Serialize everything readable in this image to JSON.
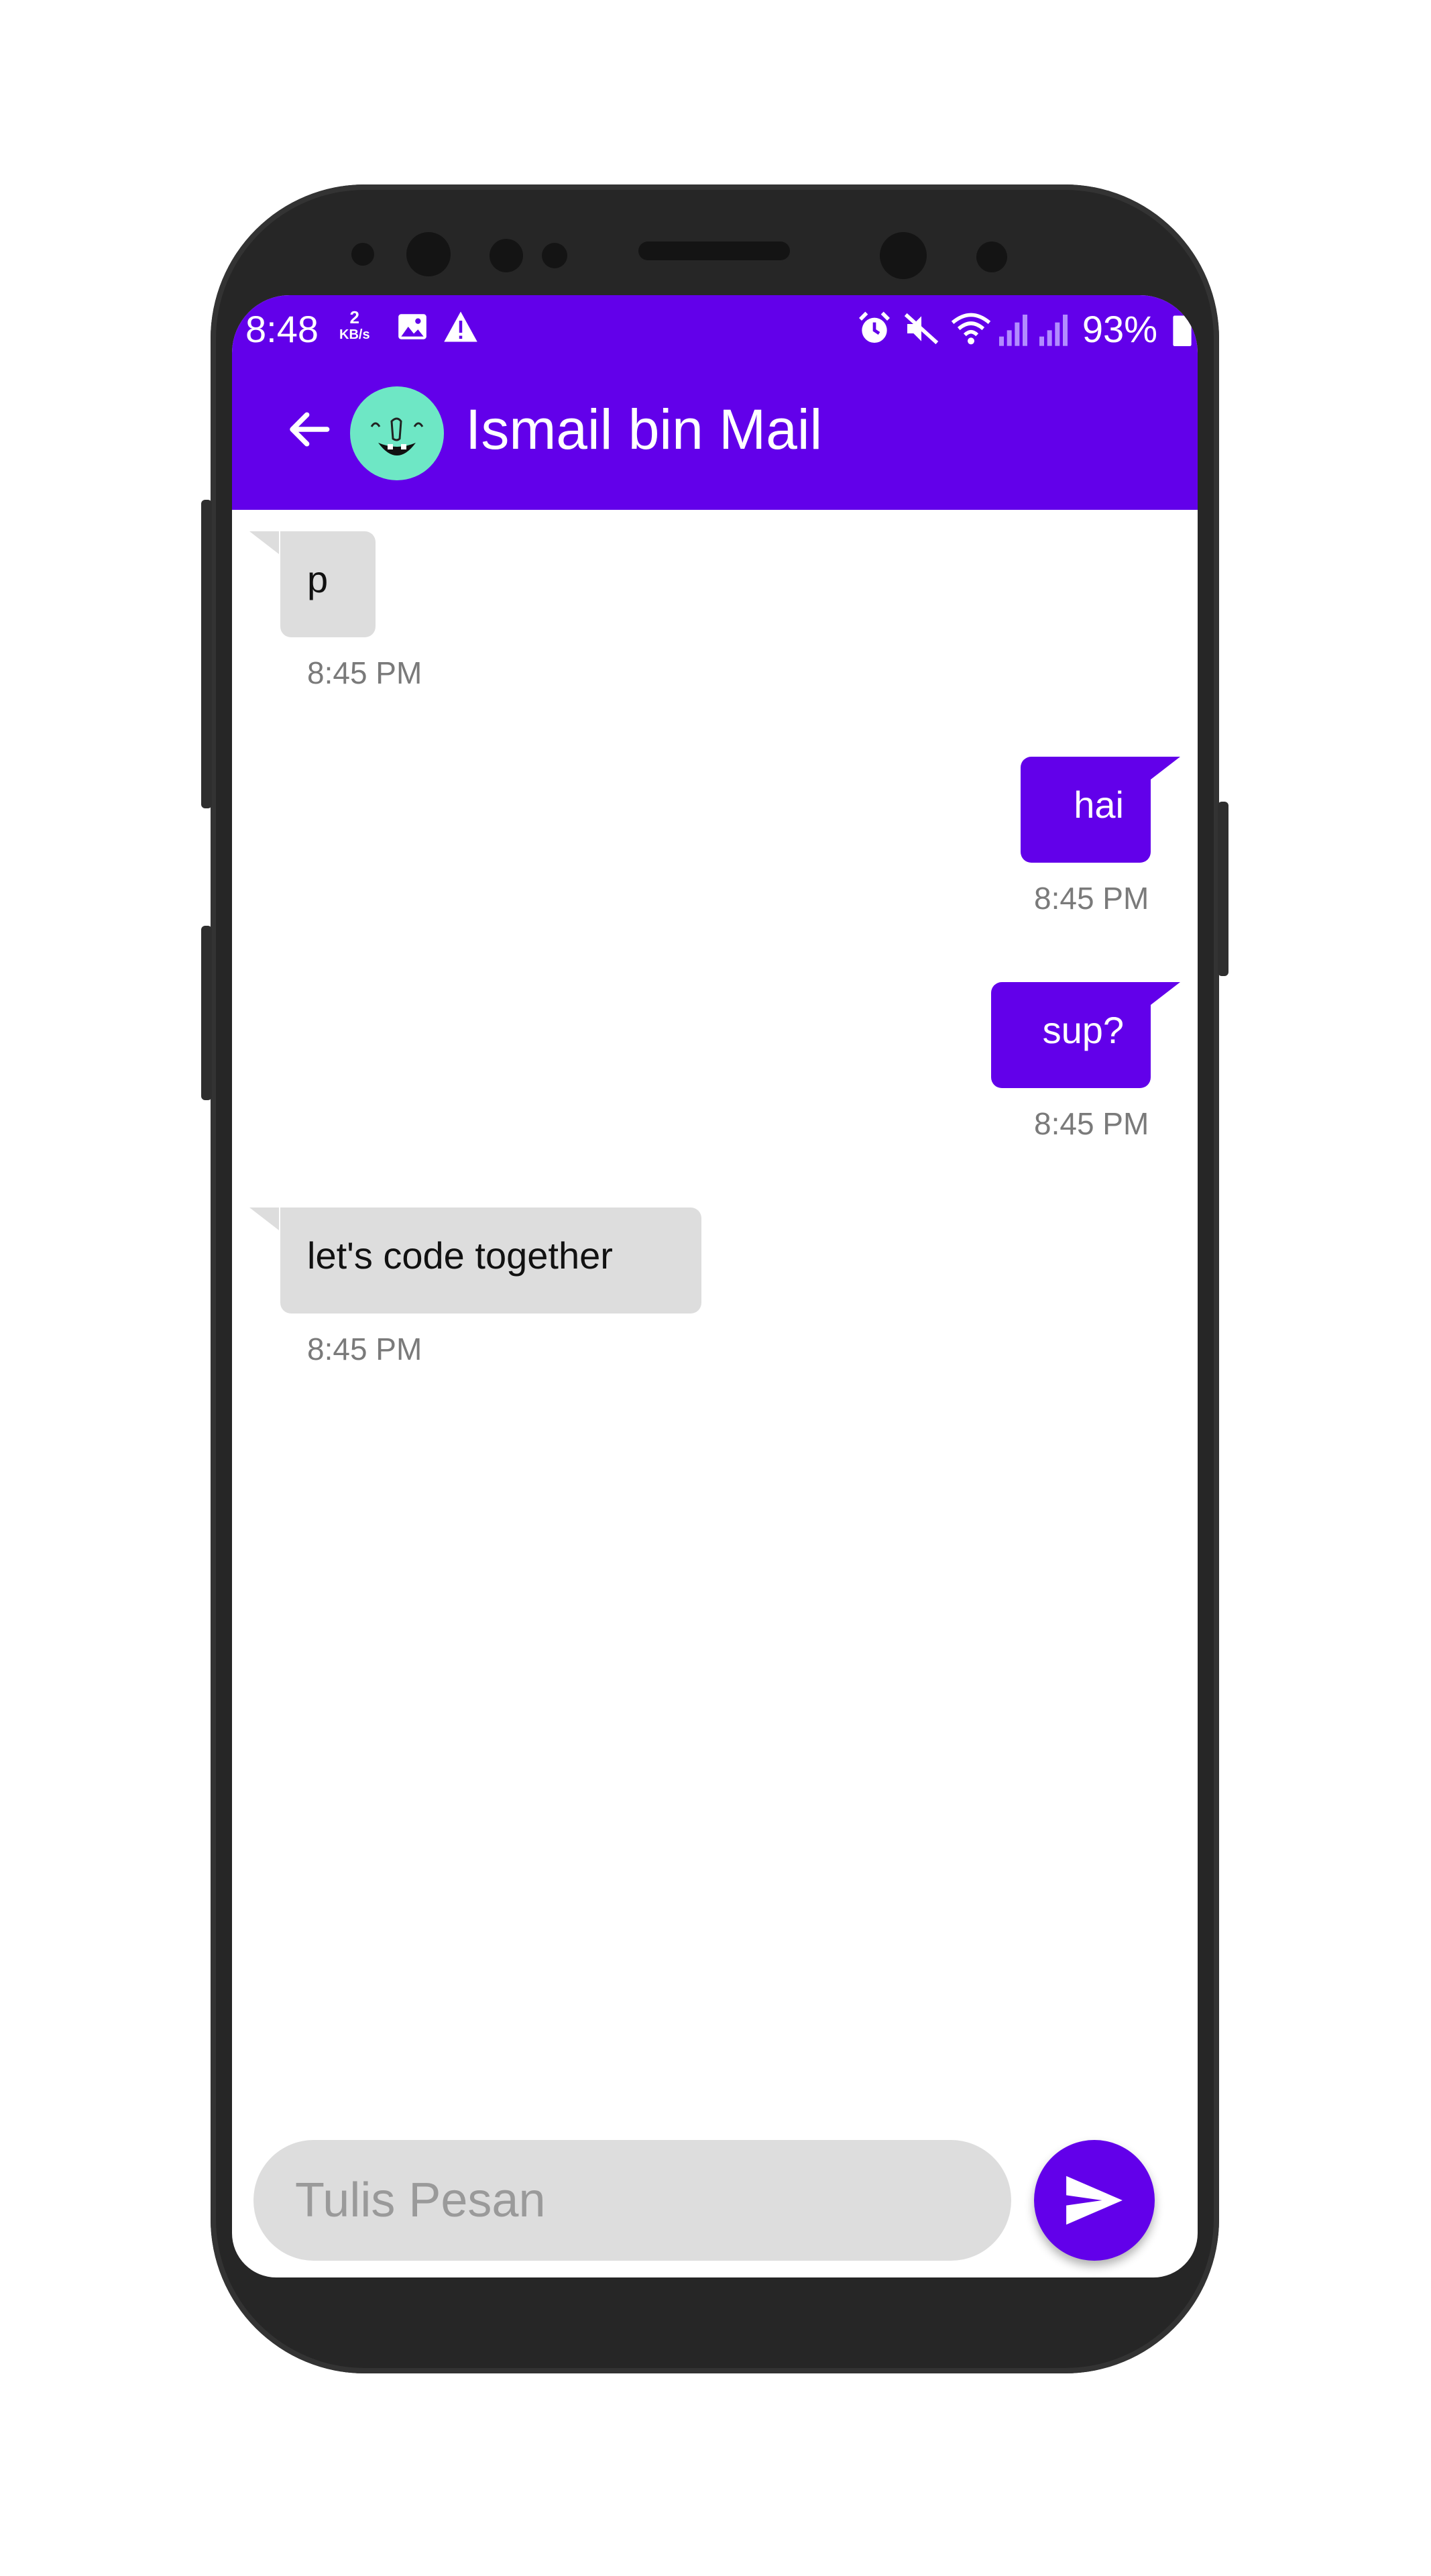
{
  "status_bar": {
    "time": "8:48",
    "net_speed_value": "2",
    "net_speed_unit": "KB/s",
    "battery": "93%",
    "icons": [
      "image-icon",
      "warning-icon",
      "alarm-icon",
      "mute-icon",
      "wifi-icon",
      "signal-icon",
      "signal-icon",
      "battery-icon"
    ]
  },
  "header": {
    "title": "Ismail bin Mail",
    "back_icon": "arrow-left-icon",
    "avatar": "avatar"
  },
  "messages": [
    {
      "direction": "in",
      "text": "p",
      "time": "8:45 PM"
    },
    {
      "direction": "out",
      "text": "hai",
      "time": "8:45 PM"
    },
    {
      "direction": "out",
      "text": "sup?",
      "time": "8:45 PM"
    },
    {
      "direction": "in",
      "text": "let's code together",
      "time": "8:45 PM"
    }
  ],
  "composer": {
    "placeholder": "Tulis Pesan",
    "send_icon": "send-icon"
  },
  "colors": {
    "primary": "#6200ea",
    "incoming_bubble": "#dddddd",
    "avatar_bg": "#6ee7c5"
  }
}
